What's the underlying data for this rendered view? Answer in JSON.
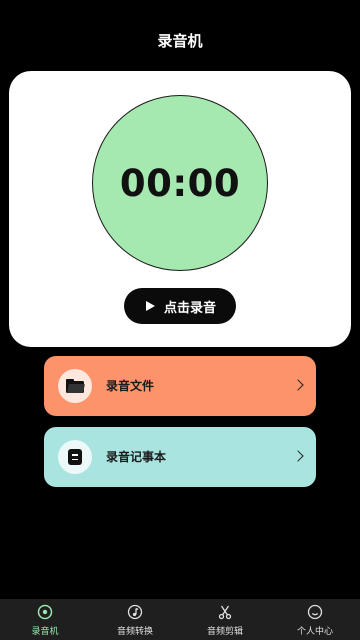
{
  "header": {
    "title": "录音机"
  },
  "recorder": {
    "time": "00:00",
    "record_label": "点击录音",
    "circle_color": "#a5e8b0"
  },
  "menu": [
    {
      "label": "录音文件",
      "icon": "folder-icon",
      "color": "#fd936a"
    },
    {
      "label": "录音记事本",
      "icon": "notebook-icon",
      "color": "#a9e4e0"
    }
  ],
  "tabs": [
    {
      "label": "录音机",
      "icon": "record-disc-icon",
      "active": true
    },
    {
      "label": "音频转换",
      "icon": "convert-icon",
      "active": false
    },
    {
      "label": "音频剪辑",
      "icon": "scissors-icon",
      "active": false
    },
    {
      "label": "个人中心",
      "icon": "profile-icon",
      "active": false
    }
  ],
  "colors": {
    "accent": "#9be7ae",
    "background": "#000000",
    "tab_bar": "#1f1f1f"
  }
}
